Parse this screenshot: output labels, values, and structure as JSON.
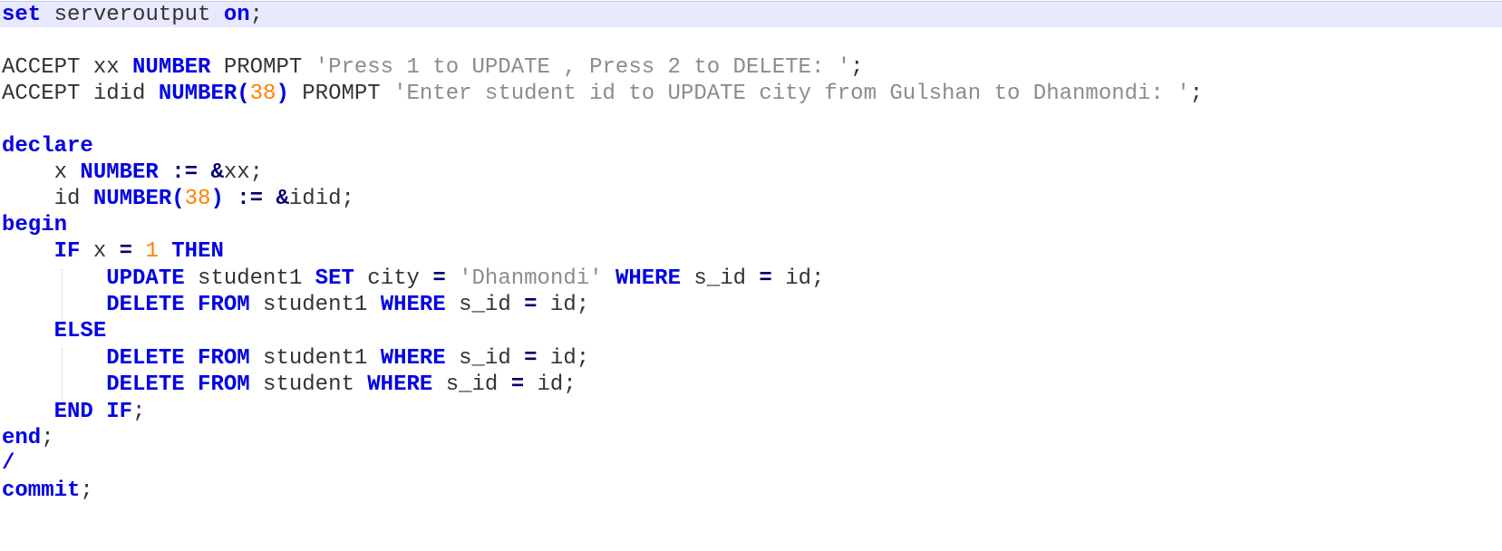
{
  "editor": {
    "current_line_color": "#e8e8ff",
    "keyword_color": "#0000e6",
    "string_color": "#8c8c8c",
    "number_color": "#ff8000",
    "text_color": "#333333",
    "lines": [
      {
        "tokens": [
          {
            "t": "set",
            "c": "kw"
          },
          {
            "t": " serveroutput ",
            "c": "plain"
          },
          {
            "t": "on",
            "c": "kw"
          },
          {
            "t": ";",
            "c": "plain"
          }
        ]
      },
      {
        "tokens": []
      },
      {
        "tokens": [
          {
            "t": "ACCEPT xx ",
            "c": "plain"
          },
          {
            "t": "NUMBER",
            "c": "kw"
          },
          {
            "t": " PROMPT ",
            "c": "plain"
          },
          {
            "t": "'Press 1 to UPDATE , Press 2 to DELETE: '",
            "c": "str"
          },
          {
            "t": ";",
            "c": "plain"
          }
        ]
      },
      {
        "tokens": [
          {
            "t": "ACCEPT idid ",
            "c": "plain"
          },
          {
            "t": "NUMBER(",
            "c": "kw"
          },
          {
            "t": "38",
            "c": "num"
          },
          {
            "t": ")",
            "c": "kw"
          },
          {
            "t": " PROMPT ",
            "c": "plain"
          },
          {
            "t": "'Enter student id to UPDATE city from Gulshan to Dhanmondi: '",
            "c": "str"
          },
          {
            "t": ";",
            "c": "plain"
          }
        ]
      },
      {
        "tokens": []
      },
      {
        "tokens": [
          {
            "t": "declare",
            "c": "kw"
          }
        ]
      },
      {
        "tokens": [
          {
            "t": "    x ",
            "c": "plain"
          },
          {
            "t": "NUMBER",
            "c": "kw"
          },
          {
            "t": " ",
            "c": "plain"
          },
          {
            "t": ":=",
            "c": "op"
          },
          {
            "t": " ",
            "c": "plain"
          },
          {
            "t": "&",
            "c": "op"
          },
          {
            "t": "xx;",
            "c": "plain"
          }
        ]
      },
      {
        "tokens": [
          {
            "t": "    id ",
            "c": "plain"
          },
          {
            "t": "NUMBER(",
            "c": "kw"
          },
          {
            "t": "38",
            "c": "num"
          },
          {
            "t": ")",
            "c": "kw"
          },
          {
            "t": " ",
            "c": "plain"
          },
          {
            "t": ":=",
            "c": "op"
          },
          {
            "t": " ",
            "c": "plain"
          },
          {
            "t": "&",
            "c": "op"
          },
          {
            "t": "idid;",
            "c": "plain"
          }
        ]
      },
      {
        "tokens": [
          {
            "t": "begin",
            "c": "kw"
          }
        ]
      },
      {
        "tokens": [
          {
            "t": "    ",
            "c": "plain"
          },
          {
            "t": "IF",
            "c": "kw"
          },
          {
            "t": " x ",
            "c": "plain"
          },
          {
            "t": "=",
            "c": "op"
          },
          {
            "t": " ",
            "c": "plain"
          },
          {
            "t": "1",
            "c": "num"
          },
          {
            "t": " ",
            "c": "plain"
          },
          {
            "t": "THEN",
            "c": "kw"
          }
        ]
      },
      {
        "tokens": [
          {
            "t": "        ",
            "c": "plain"
          },
          {
            "t": "UPDATE",
            "c": "kw"
          },
          {
            "t": " student1 ",
            "c": "plain"
          },
          {
            "t": "SET",
            "c": "kw"
          },
          {
            "t": " city ",
            "c": "plain"
          },
          {
            "t": "=",
            "c": "op"
          },
          {
            "t": " ",
            "c": "plain"
          },
          {
            "t": "'Dhanmondi'",
            "c": "str"
          },
          {
            "t": " ",
            "c": "plain"
          },
          {
            "t": "WHERE",
            "c": "kw"
          },
          {
            "t": " s_id ",
            "c": "plain"
          },
          {
            "t": "=",
            "c": "op"
          },
          {
            "t": " id;",
            "c": "plain"
          }
        ]
      },
      {
        "tokens": [
          {
            "t": "        ",
            "c": "plain"
          },
          {
            "t": "DELETE",
            "c": "kw"
          },
          {
            "t": " ",
            "c": "plain"
          },
          {
            "t": "FROM",
            "c": "kw"
          },
          {
            "t": " student1 ",
            "c": "plain"
          },
          {
            "t": "WHERE",
            "c": "kw"
          },
          {
            "t": " s_id ",
            "c": "plain"
          },
          {
            "t": "=",
            "c": "op"
          },
          {
            "t": " id;",
            "c": "plain"
          }
        ]
      },
      {
        "tokens": [
          {
            "t": "    ",
            "c": "plain"
          },
          {
            "t": "ELSE",
            "c": "kw"
          }
        ]
      },
      {
        "tokens": [
          {
            "t": "        ",
            "c": "plain"
          },
          {
            "t": "DELETE",
            "c": "kw"
          },
          {
            "t": " ",
            "c": "plain"
          },
          {
            "t": "FROM",
            "c": "kw"
          },
          {
            "t": " student1 ",
            "c": "plain"
          },
          {
            "t": "WHERE",
            "c": "kw"
          },
          {
            "t": " s_id ",
            "c": "plain"
          },
          {
            "t": "=",
            "c": "op"
          },
          {
            "t": " id;",
            "c": "plain"
          }
        ]
      },
      {
        "tokens": [
          {
            "t": "        ",
            "c": "plain"
          },
          {
            "t": "DELETE",
            "c": "kw"
          },
          {
            "t": " ",
            "c": "plain"
          },
          {
            "t": "FROM",
            "c": "kw"
          },
          {
            "t": " student ",
            "c": "plain"
          },
          {
            "t": "WHERE",
            "c": "kw"
          },
          {
            "t": " s_id ",
            "c": "plain"
          },
          {
            "t": "=",
            "c": "op"
          },
          {
            "t": " id;",
            "c": "plain"
          }
        ]
      },
      {
        "tokens": [
          {
            "t": "    ",
            "c": "plain"
          },
          {
            "t": "END",
            "c": "kw"
          },
          {
            "t": " ",
            "c": "plain"
          },
          {
            "t": "IF",
            "c": "kw"
          },
          {
            "t": ";",
            "c": "plain"
          }
        ]
      },
      {
        "tokens": [
          {
            "t": "end",
            "c": "kw"
          },
          {
            "t": ";",
            "c": "plain"
          }
        ]
      },
      {
        "tokens": [
          {
            "t": "/",
            "c": "kw"
          }
        ]
      },
      {
        "tokens": [
          {
            "t": "commit",
            "c": "kw"
          },
          {
            "t": ";",
            "c": "plain"
          }
        ]
      }
    ]
  }
}
